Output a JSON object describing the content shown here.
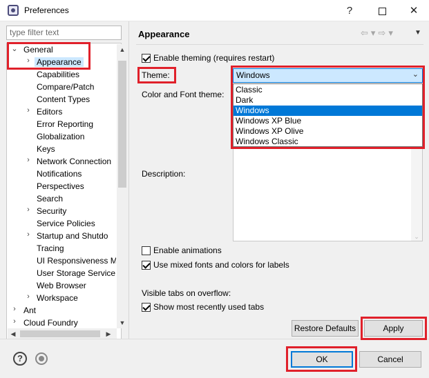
{
  "window": {
    "title": "Preferences",
    "help_button": "?",
    "close_button": "✕"
  },
  "filter": {
    "placeholder": "type filter text"
  },
  "tree": {
    "items": [
      {
        "label": "General",
        "arrow": "⌄"
      },
      {
        "label": "Appearance",
        "arrow": "›"
      },
      {
        "label": "Capabilities"
      },
      {
        "label": "Compare/Patch"
      },
      {
        "label": "Content Types"
      },
      {
        "label": "Editors",
        "arrow": "›"
      },
      {
        "label": "Error Reporting"
      },
      {
        "label": "Globalization"
      },
      {
        "label": "Keys"
      },
      {
        "label": "Network Connection",
        "arrow": "›"
      },
      {
        "label": "Notifications"
      },
      {
        "label": "Perspectives"
      },
      {
        "label": "Search"
      },
      {
        "label": "Security",
        "arrow": "›"
      },
      {
        "label": "Service Policies"
      },
      {
        "label": "Startup and Shutdo",
        "arrow": "›"
      },
      {
        "label": "Tracing"
      },
      {
        "label": "UI Responsiveness M"
      },
      {
        "label": "User Storage Service"
      },
      {
        "label": "Web Browser"
      },
      {
        "label": "Workspace",
        "arrow": "›"
      },
      {
        "label": "Ant",
        "arrow": "›"
      },
      {
        "label": "Cloud Foundry",
        "arrow": "›"
      }
    ]
  },
  "page": {
    "title": "Appearance",
    "enable_theming": "Enable theming (requires restart)",
    "theme_label": "Theme:",
    "theme_value": "Windows",
    "color_font_label": "Color and Font theme:",
    "description_label": "Description:",
    "theme_options": [
      "Classic",
      "Dark",
      "Windows",
      "Windows XP Blue",
      "Windows XP Olive",
      "Windows Classic"
    ],
    "enable_animations": "Enable animations",
    "mixed_fonts": "Use mixed fonts and colors for labels",
    "visible_tabs": "Visible tabs on overflow:",
    "recent_tabs": "Show most recently used tabs",
    "restore_defaults": "Restore Defaults",
    "apply": "Apply"
  },
  "footer": {
    "ok": "OK",
    "cancel": "Cancel",
    "help": "?"
  },
  "colors": {
    "highlight": "#e0202a",
    "selection": "#0078d7",
    "selected_bg": "#cce8ff"
  }
}
